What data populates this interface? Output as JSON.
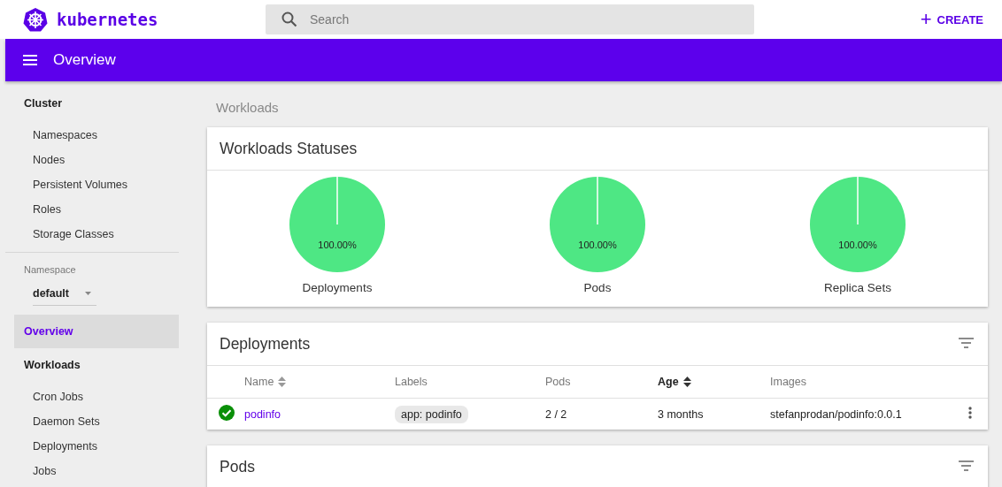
{
  "header": {
    "logo_text": "kubernetes",
    "search": {
      "placeholder": "Search"
    },
    "create_button": {
      "icon": "+",
      "label": "CREATE"
    }
  },
  "toolbar": {
    "title": "Overview"
  },
  "sidebar": {
    "sections": [
      {
        "title": "Cluster",
        "items": [
          {
            "label": "Namespaces"
          },
          {
            "label": "Nodes"
          },
          {
            "label": "Persistent Volumes"
          },
          {
            "label": "Roles"
          },
          {
            "label": "Storage Classes"
          }
        ]
      }
    ],
    "namespace": {
      "label": "Namespace",
      "value": "default"
    },
    "overview": {
      "label": "Overview",
      "selected": true
    },
    "workloads": {
      "title": "Workloads",
      "items": [
        {
          "label": "Cron Jobs"
        },
        {
          "label": "Daemon Sets"
        },
        {
          "label": "Deployments"
        },
        {
          "label": "Jobs"
        }
      ]
    }
  },
  "breadcrumb": "Workloads",
  "statuses": {
    "title": "Workloads Statuses",
    "charts": [
      {
        "label": "Deployments",
        "chart_data": {
          "type": "pie",
          "value_labels": [
            "100.00%"
          ],
          "series": [
            {
              "color": "#4ee784",
              "values": [
                100
              ]
            }
          ]
        }
      },
      {
        "label": "Pods",
        "chart_data": {
          "type": "pie",
          "value_labels": [
            "100.00%"
          ],
          "series": [
            {
              "color": "#4ee784",
              "values": [
                100
              ]
            }
          ]
        }
      },
      {
        "label": "Replica Sets",
        "chart_data": {
          "type": "pie",
          "value_labels": [
            "100.00%"
          ],
          "series": [
            {
              "color": "#4ee784",
              "values": [
                100
              ]
            }
          ]
        }
      }
    ]
  },
  "deployments": {
    "title": "Deployments",
    "columns": [
      {
        "label": "Name",
        "sortable": true,
        "selected": false
      },
      {
        "label": "Labels",
        "sortable": false,
        "selected": false
      },
      {
        "label": "Pods",
        "sortable": false,
        "selected": false
      },
      {
        "label": "Age",
        "sortable": true,
        "selected": true
      },
      {
        "label": "Images",
        "sortable": false,
        "selected": false
      }
    ],
    "rows": [
      {
        "healthy": true,
        "name": "podinfo",
        "labels": [
          "app: podinfo"
        ],
        "pods": "2 / 2",
        "age": "3 months",
        "images": "stefanprodan/podinfo:0.0.1"
      }
    ]
  },
  "pods": {
    "title": "Pods"
  }
}
